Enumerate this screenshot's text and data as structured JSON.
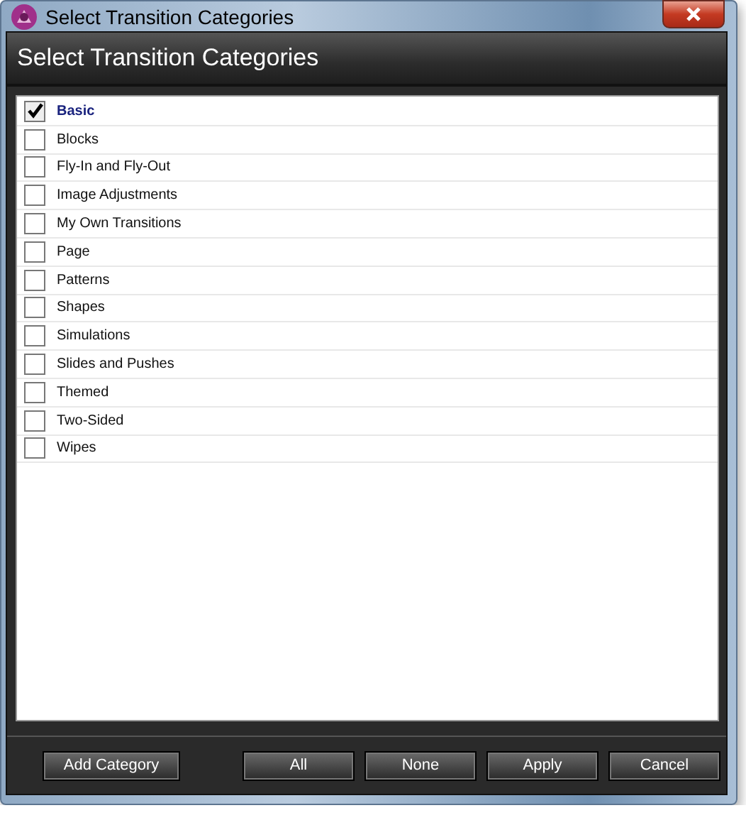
{
  "window": {
    "title": "Select Transition Categories"
  },
  "dialog": {
    "heading": "Select Transition Categories"
  },
  "categories": [
    {
      "label": "Basic",
      "checked": true
    },
    {
      "label": "Blocks",
      "checked": false
    },
    {
      "label": "Fly-In and Fly-Out",
      "checked": false
    },
    {
      "label": "Image Adjustments",
      "checked": false
    },
    {
      "label": "My Own Transitions",
      "checked": false
    },
    {
      "label": "Page",
      "checked": false
    },
    {
      "label": "Patterns",
      "checked": false
    },
    {
      "label": "Shapes",
      "checked": false
    },
    {
      "label": "Simulations",
      "checked": false
    },
    {
      "label": "Slides and Pushes",
      "checked": false
    },
    {
      "label": "Themed",
      "checked": false
    },
    {
      "label": "Two-Sided",
      "checked": false
    },
    {
      "label": "Wipes",
      "checked": false
    }
  ],
  "buttons": [
    "Add Category",
    "All",
    "None",
    "Apply",
    "Cancel"
  ]
}
